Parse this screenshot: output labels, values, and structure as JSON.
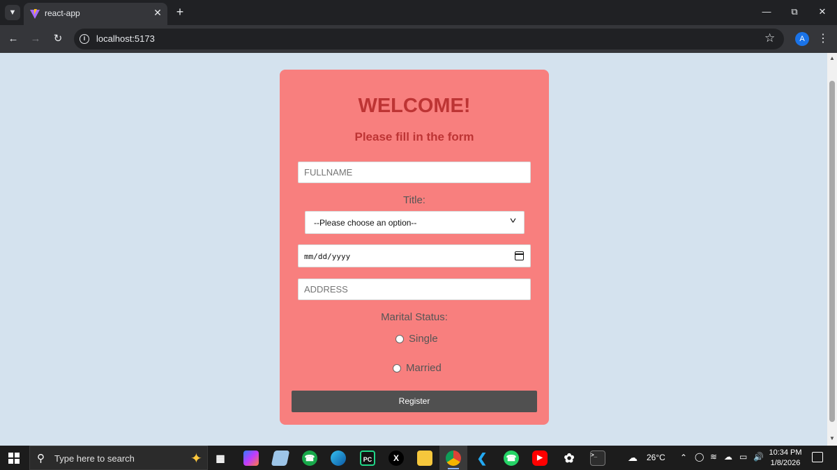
{
  "browser": {
    "tab_title": "react-app",
    "url": "localhost:5173"
  },
  "form": {
    "heading": "WELCOME!",
    "subheading": "Please fill in the form",
    "fullname_placeholder": "FULLNAME",
    "title_label": "Title:",
    "title_selected": "--Please choose an option--",
    "date_placeholder": "mm/dd/yyyy",
    "address_placeholder": "ADDRESS",
    "marital_label": "Marital Status:",
    "options": [
      "Single",
      "Married"
    ],
    "register_label": "Register"
  },
  "taskbar": {
    "search_placeholder": "Type here to search",
    "weather": "26°C",
    "time": "10:34 PM",
    "date": "1/8/2026"
  },
  "colors": {
    "page_bg": "#d4e2ee",
    "card_bg": "#f87f7e",
    "heading": "#bd3434",
    "button_bg": "#505050"
  }
}
